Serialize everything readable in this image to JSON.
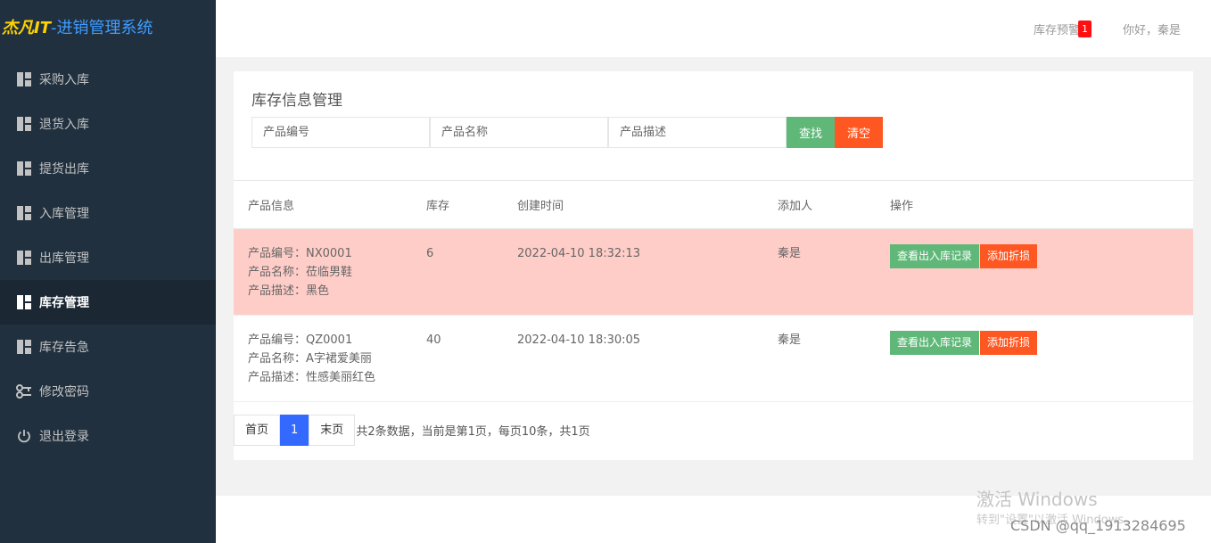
{
  "logo": {
    "brand": "杰凡IT",
    "system": "-进销管理系统"
  },
  "sidebar": {
    "items": [
      {
        "label": "采购入库",
        "icon": "layout-icon"
      },
      {
        "label": "退货入库",
        "icon": "layout-icon"
      },
      {
        "label": "提货出库",
        "icon": "layout-icon"
      },
      {
        "label": "入库管理",
        "icon": "layout-icon"
      },
      {
        "label": "出库管理",
        "icon": "layout-icon"
      },
      {
        "label": "库存管理",
        "icon": "layout-icon",
        "active": true
      },
      {
        "label": "库存告急",
        "icon": "layout-icon"
      },
      {
        "label": "修改密码",
        "icon": "key-icon"
      },
      {
        "label": "退出登录",
        "icon": "power-icon"
      }
    ]
  },
  "header": {
    "alert_label": "库存预警",
    "alert_count": "1",
    "greeting": "你好，秦是"
  },
  "main": {
    "title": "库存信息管理",
    "search": {
      "code_placeholder": "产品编号",
      "name_placeholder": "产品名称",
      "desc_placeholder": "产品描述",
      "find_label": "查找",
      "clear_label": "清空"
    },
    "table": {
      "headers": [
        "产品信息",
        "库存",
        "创建时间",
        "添加人",
        "操作"
      ],
      "rows": [
        {
          "code": "产品编号：NX0001",
          "name": "产品名称：莅临男鞋",
          "desc": "产品描述：黑色",
          "stock": "6",
          "created": "2022-04-10 18:32:13",
          "adder": "秦是",
          "view_label": "查看出入库记录",
          "loss_label": "添加折损",
          "warning": true
        },
        {
          "code": "产品编号：QZ0001",
          "name": "产品名称：A字裙爱美丽",
          "desc": "产品描述：性感美丽红色",
          "stock": "40",
          "created": "2022-04-10 18:30:05",
          "adder": "秦是",
          "view_label": "查看出入库记录",
          "loss_label": "添加折损",
          "warning": false
        }
      ]
    },
    "pager": {
      "first": "首页",
      "current": "1",
      "last": "末页",
      "info": "共2条数据，当前是第1页，每页10条，共1页"
    }
  },
  "watermark": {
    "line1": "激活 Windows",
    "line2": "转到\"设置\"以激活 Windows。",
    "csdn": "CSDN @qq_1913284695"
  },
  "colors": {
    "sidebar_bg": "#20303f",
    "brand": "#ffd200",
    "accent_blue": "#3369ff",
    "green": "#5fb878",
    "red": "#ff5722",
    "warning_row": "#ffcdc8"
  }
}
